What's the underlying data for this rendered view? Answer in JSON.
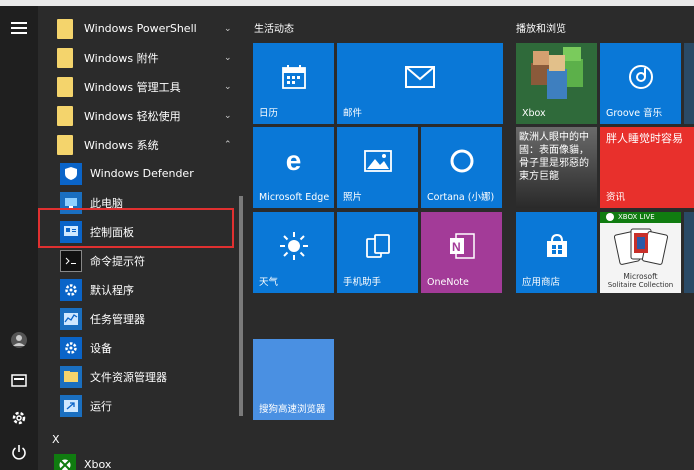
{
  "start_menu": {
    "apps": [
      {
        "label": "Windows PowerShell",
        "kind": "folder"
      },
      {
        "label": "Windows 附件",
        "kind": "folder"
      },
      {
        "label": "Windows 管理工具",
        "kind": "folder"
      },
      {
        "label": "Windows 轻松使用",
        "kind": "folder"
      },
      {
        "label": "Windows 系统",
        "kind": "folder-open"
      },
      {
        "label": "Windows Defender",
        "kind": "sub"
      },
      {
        "label": "此电脑",
        "kind": "sub"
      },
      {
        "label": "控制面板",
        "kind": "sub"
      },
      {
        "label": "命令提示符",
        "kind": "sub"
      },
      {
        "label": "默认程序",
        "kind": "sub"
      },
      {
        "label": "任务管理器",
        "kind": "sub"
      },
      {
        "label": "设备",
        "kind": "sub"
      },
      {
        "label": "文件资源管理器",
        "kind": "sub"
      },
      {
        "label": "运行",
        "kind": "sub"
      }
    ],
    "letter_header": "X",
    "last_app": "Xbox"
  },
  "tiles": {
    "section_left": "生活动态",
    "section_right": "播放和浏览",
    "items": {
      "calendar": "日历",
      "mail": "邮件",
      "edge": "Microsoft Edge",
      "photos": "照片",
      "cortana": "Cortana (小娜)",
      "weather": "天气",
      "phone": "手机助手",
      "onenote": "OneNote",
      "xbox": "Xbox",
      "groove": "Groove 音乐",
      "news_headline": "歐洲人眼中的中國：表面像貓，骨子里是邪惡的東方巨龍",
      "info_headline": "胖人睡觉时容易",
      "info_label": "资讯",
      "store": "应用商店",
      "solitaire_badge": "XBOX LIVE",
      "solitaire_line1": "Microsoft",
      "solitaire_line2": "Solitaire Collection",
      "search_browser": "搜狗高速浏览器"
    }
  },
  "colors": {
    "tile_blue": "#0a78d7",
    "onenote_purple": "#a33b98",
    "xbox_green": "#107c10",
    "info_red": "#e8302c",
    "highlight_red": "#e03030"
  }
}
